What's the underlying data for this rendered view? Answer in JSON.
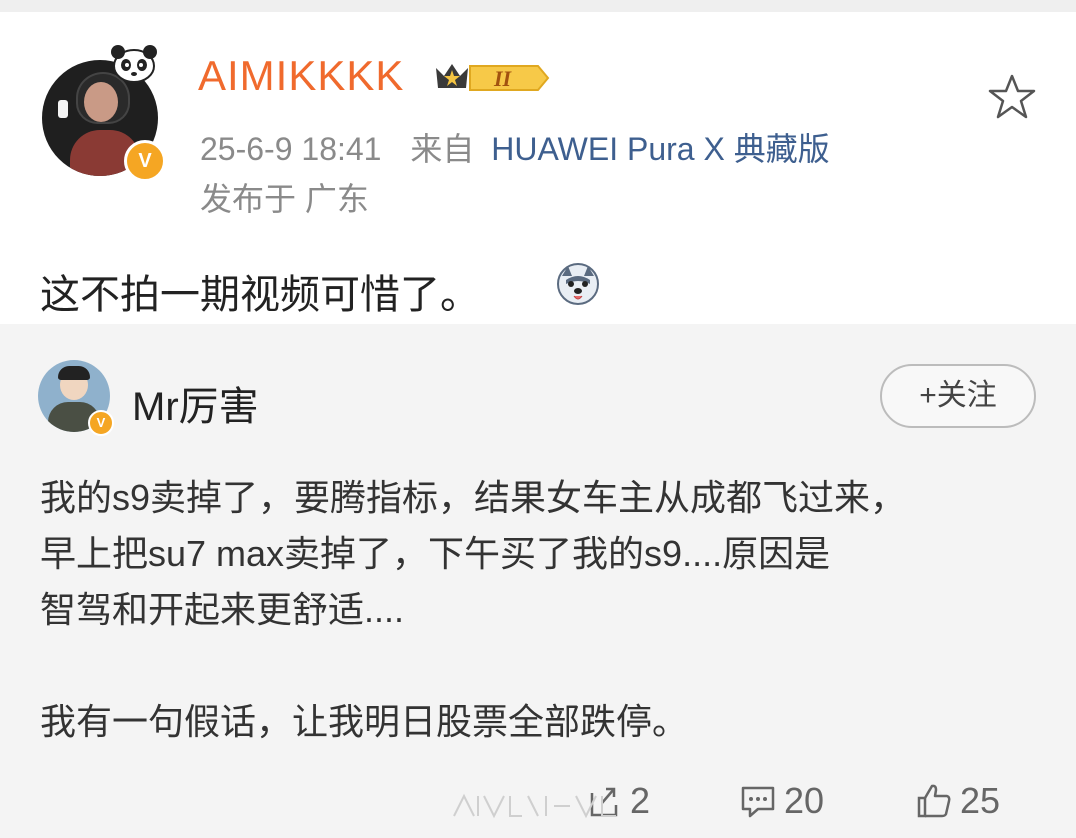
{
  "post": {
    "username": "AIMIKKKK",
    "level_badge": "II",
    "timestamp": "25-6-9 18:41",
    "from_label": "来自",
    "device": "HUAWEI Pura X 典藏版",
    "location": "发布于 广东",
    "text": "这不拍一期视频可惜了。",
    "verified_mark": "V"
  },
  "quoted": {
    "author": "Mr厉害",
    "verified_mark": "V",
    "follow_label": "+关注",
    "paragraphs": [
      "我的s9卖掉了，要腾指标，结果女车主从成都飞过来，",
      "早上把su7 max卖掉了，下午买了我的s9....原因是",
      "智驾和开起来更舒适....",
      "我有一句假话，让我明日股票全部跌停。"
    ],
    "repost_count": "2",
    "comment_count": "20",
    "like_count": "25"
  },
  "icons": {
    "favorite": "star-outline-icon",
    "repost": "repost-icon",
    "comment": "comment-icon",
    "like": "thumbs-up-icon",
    "emoji": "husky-emoji-icon"
  },
  "colors": {
    "username": "#f06a2d",
    "device_link": "#3e5f8f",
    "meta_gray": "#8a8a8a",
    "badge_orange": "#f5a623"
  }
}
